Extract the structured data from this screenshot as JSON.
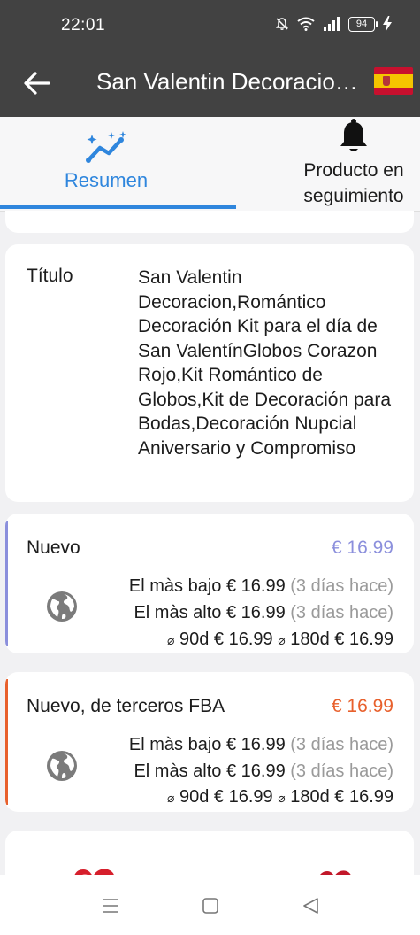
{
  "status_bar": {
    "time": "22:01",
    "battery": "94",
    "icons": [
      "silent-bell-icon",
      "wifi-icon",
      "signal-icon",
      "battery-icon",
      "charging-bolt-icon"
    ]
  },
  "app_bar": {
    "title": "San Valentin Decoracion,Romántico Decoración Kit",
    "back_icon": "arrow-left-icon",
    "flag_icon": "spain-flag-icon"
  },
  "tabs": [
    {
      "label": "Resumen",
      "icon": "trend-chart-icon",
      "active": true,
      "color": "#2f86dd"
    },
    {
      "label": "Producto en seguimiento",
      "icon": "bell-icon",
      "active": false
    }
  ],
  "title_card": {
    "key": "Título",
    "value": "San Valentin Decoracion,Romántico Decoración Kit para el día de San ValentínGlobos Corazon Rojo,Kit Romántico de Globos,Kit de Decoración para Bodas,Decoración Nupcial Aniversario y Compromiso"
  },
  "offers": [
    {
      "name": "Nuevo",
      "price": "€ 16.99",
      "accent_color": "#8b8fdc",
      "icon": "globe-icon",
      "low_label": "El màs bajo",
      "low_value": "€ 16.99",
      "low_when": "(3 días hace)",
      "high_label": "El màs alto",
      "high_value": "€ 16.99",
      "high_when": "(3 días hace)",
      "avg_symbol": "⌀",
      "avg90_label": "90d",
      "avg90_value": "€ 16.99",
      "avg180_label": "180d",
      "avg180_value": "€ 16.99"
    },
    {
      "name": "Nuevo, de terceros FBA",
      "price": "€ 16.99",
      "accent_color": "#e8602c",
      "icon": "globe-icon",
      "low_label": "El màs bajo",
      "low_value": "€ 16.99",
      "low_when": "(3 días hace)",
      "high_label": "El màs alto",
      "high_value": "€ 16.99",
      "high_when": "(3 días hace)",
      "avg_symbol": "⌀",
      "avg90_label": "90d",
      "avg90_value": "€ 16.99",
      "avg180_label": "180d",
      "avg180_value": "€ 16.99"
    }
  ],
  "nav_bar": {
    "icons": [
      "menu-icon",
      "home-square-icon",
      "back-triangle-icon"
    ]
  }
}
